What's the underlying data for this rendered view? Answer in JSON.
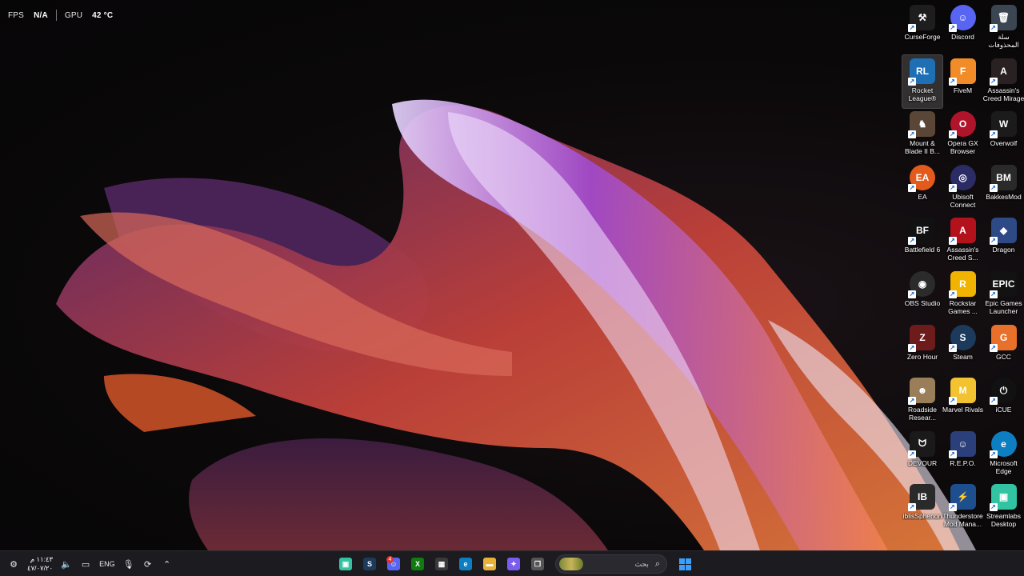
{
  "overlay": {
    "fps_label": "FPS",
    "fps_value": "N/A",
    "gpu_label": "GPU",
    "gpu_value": "42 °C"
  },
  "desktop_icons": [
    {
      "label": "CurseForge",
      "icon": "curseforge-icon",
      "color": "#1e1e1e",
      "glyph": "⚒"
    },
    {
      "label": "Discord",
      "icon": "discord-icon",
      "color": "#5865f2",
      "glyph": "☺",
      "round": true
    },
    {
      "label": "سلة المحذوفات",
      "icon": "recycle-bin-icon",
      "color": "#3c4652",
      "glyph": "🗑"
    },
    {
      "label": "Rocket League®",
      "icon": "rocket-league-icon",
      "color": "#1f6fb5",
      "glyph": "RL",
      "selected": true
    },
    {
      "label": "FiveM",
      "icon": "fivem-icon",
      "color": "#f28c28",
      "glyph": "F"
    },
    {
      "label": "Assassin's Creed Mirage",
      "icon": "assassins-creed-mirage-icon",
      "color": "#2a2222",
      "glyph": "A"
    },
    {
      "label": "Mount & Blade II B...",
      "icon": "mount-and-blade-icon",
      "color": "#5a4636",
      "glyph": "♞"
    },
    {
      "label": "Opera GX Browser",
      "icon": "opera-gx-icon",
      "color": "#b0142a",
      "glyph": "O",
      "round": true
    },
    {
      "label": "Overwolf",
      "icon": "overwolf-icon",
      "color": "#1b1b1b",
      "glyph": "W"
    },
    {
      "label": "EA",
      "icon": "ea-icon",
      "color": "#e25a1c",
      "glyph": "EA",
      "round": true
    },
    {
      "label": "Ubisoft Connect",
      "icon": "ubisoft-connect-icon",
      "color": "#2b2b66",
      "glyph": "◎",
      "round": true
    },
    {
      "label": "BakkesMod",
      "icon": "bakkesmod-icon",
      "color": "#2a2a2a",
      "glyph": "BM"
    },
    {
      "label": "Battlefield 6",
      "icon": "battlefield-icon",
      "color": "#111111",
      "glyph": "BF"
    },
    {
      "label": "Assassin's Creed S...",
      "icon": "assassins-creed-shadows-icon",
      "color": "#b3121c",
      "glyph": "A"
    },
    {
      "label": "Dragon",
      "icon": "dragon-icon",
      "color": "#2d4a86",
      "glyph": "◆"
    },
    {
      "label": "OBS Studio",
      "icon": "obs-studio-icon",
      "color": "#2b2b2b",
      "glyph": "◉",
      "round": true
    },
    {
      "label": "Rockstar Games ...",
      "icon": "rockstar-games-icon",
      "color": "#f0b400",
      "glyph": "R"
    },
    {
      "label": "Epic Games Launcher",
      "icon": "epic-games-icon",
      "color": "#121212",
      "glyph": "EPIC"
    },
    {
      "label": "Zero Hour",
      "icon": "zero-hour-icon",
      "color": "#6e1b1b",
      "glyph": "Z"
    },
    {
      "label": "Steam",
      "icon": "steam-icon",
      "color": "#1b3a5c",
      "glyph": "S",
      "round": true
    },
    {
      "label": "GCC",
      "icon": "gcc-icon",
      "color": "#e8702a",
      "glyph": "G"
    },
    {
      "label": "Roadside Resear...",
      "icon": "roadside-research-icon",
      "color": "#9a7e5a",
      "glyph": "☻"
    },
    {
      "label": "Marvel Rivals",
      "icon": "marvel-rivals-icon",
      "color": "#f2c230",
      "glyph": "M"
    },
    {
      "label": "iCUE",
      "icon": "icue-icon",
      "color": "#111111",
      "glyph": "⏻",
      "round": true
    },
    {
      "label": "DEVOUR",
      "icon": "devour-icon",
      "color": "#1a1a1a",
      "glyph": "ᗢ"
    },
    {
      "label": "R.E.P.O.",
      "icon": "repo-icon",
      "color": "#2b3f7a",
      "glyph": "☺"
    },
    {
      "label": "Microsoft Edge",
      "icon": "microsoft-edge-icon",
      "color": "#0e7ec2",
      "glyph": "e",
      "round": true
    },
    {
      "label": "iblisSphenon",
      "icon": "iblis-icon",
      "color": "#2a2a2a",
      "glyph": "IB"
    },
    {
      "label": "Thunderstore Mod Mana...",
      "icon": "thunderstore-icon",
      "color": "#1d4f8f",
      "glyph": "⚡"
    },
    {
      "label": "Streamlabs Desktop",
      "icon": "streamlabs-icon",
      "color": "#31c3a2",
      "glyph": "▣"
    }
  ],
  "taskbar": {
    "clock_time": "١١:٤٣ م",
    "clock_date": "٤٧/٠٧/٢٠",
    "language": "ENG",
    "search_placeholder": "بحث",
    "apps": [
      {
        "name": "streamlabs",
        "icon": "streamlabs-icon",
        "color": "#31c3a2",
        "glyph": "▣"
      },
      {
        "name": "steam",
        "icon": "steam-icon",
        "color": "#1b3a5c",
        "glyph": "S"
      },
      {
        "name": "discord",
        "icon": "discord-icon",
        "color": "#5865f2",
        "glyph": "☺",
        "badge": "4"
      },
      {
        "name": "xbox",
        "icon": "xbox-icon",
        "color": "#107c10",
        "glyph": "X"
      },
      {
        "name": "microsoft-store",
        "icon": "microsoft-store-icon",
        "color": "#3a3a3a",
        "glyph": "▦"
      },
      {
        "name": "edge",
        "icon": "microsoft-edge-icon",
        "color": "#0e7ec2",
        "glyph": "e"
      },
      {
        "name": "file-explorer",
        "icon": "folder-icon",
        "color": "#e8b23a",
        "glyph": "▬"
      },
      {
        "name": "copilot",
        "icon": "copilot-icon",
        "color": "#7b5cf0",
        "glyph": "✦"
      },
      {
        "name": "task-view",
        "icon": "task-view-icon",
        "color": "#555555",
        "glyph": "❐"
      }
    ]
  },
  "colors": {
    "taskbar_bg": "#1c1b1f",
    "accent_blue": "#3aa0ff"
  }
}
